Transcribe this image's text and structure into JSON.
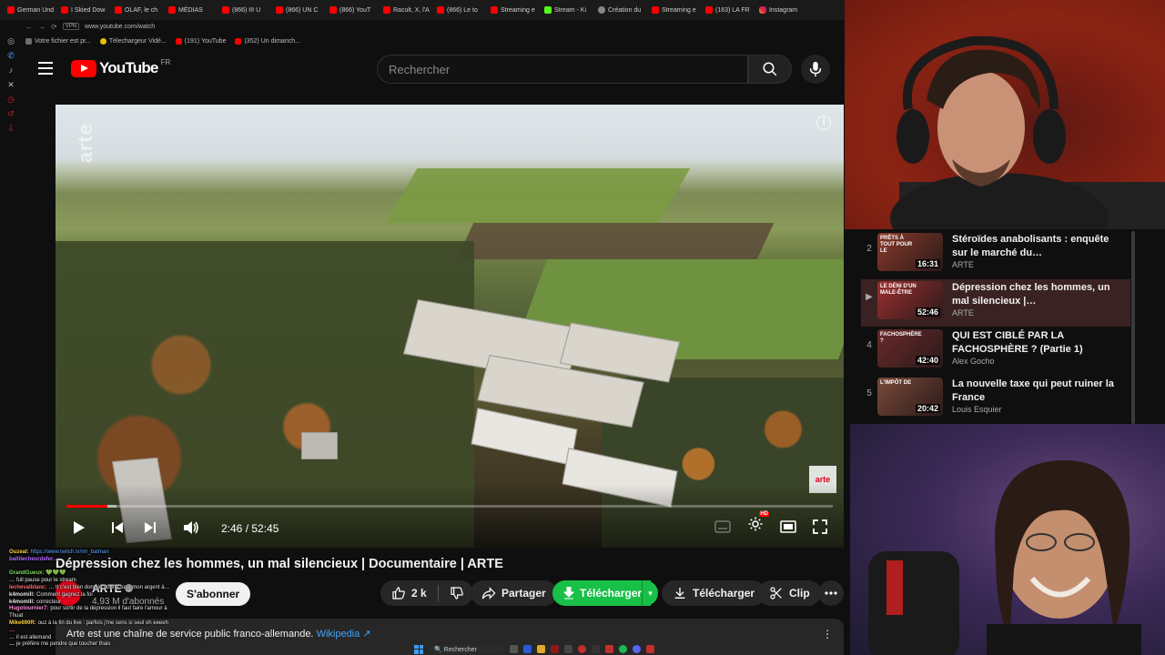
{
  "browser": {
    "tabs": [
      {
        "label": "German Und",
        "icon": "youtube"
      },
      {
        "label": "I Skied Dow",
        "icon": "youtube"
      },
      {
        "label": "OLAF, le ch",
        "icon": "youtube"
      },
      {
        "label": "MÉDIAS",
        "icon": "youtube"
      },
      {
        "label": "(866) ✉ U",
        "icon": "youtube"
      },
      {
        "label": "(866) UN C",
        "icon": "youtube"
      },
      {
        "label": "(866) YouT",
        "icon": "youtube"
      },
      {
        "label": "Racult, X, l'A",
        "icon": "youtube"
      },
      {
        "label": "(866) Le to",
        "icon": "youtube"
      },
      {
        "label": "Streaming e",
        "icon": "youtube"
      },
      {
        "label": "Stream - Ki",
        "icon": "kick"
      },
      {
        "label": "Création du",
        "icon": "generic"
      },
      {
        "label": "Streaming e",
        "icon": "youtube"
      },
      {
        "label": "(163) LA FR",
        "icon": "youtube"
      },
      {
        "label": "Instagram",
        "icon": "instagram"
      }
    ],
    "address": {
      "badge": "VPN",
      "url": "www.youtube.com/watch"
    },
    "bookmarks": [
      {
        "label": "Votre fichier est pr...",
        "icon": "generic"
      },
      {
        "label": "Télechargeur Vidé...",
        "icon": "yellow"
      },
      {
        "label": "(191) YouTube",
        "icon": "youtube"
      },
      {
        "label": "(352) Un dimanch...",
        "icon": "youtube"
      }
    ]
  },
  "header": {
    "logo_text": "YouTube",
    "country_code": "FR",
    "search_placeholder": "Rechercher"
  },
  "player": {
    "current_time": "2:46",
    "duration": "52:45",
    "time_display": "2:46 / 52:45",
    "played_fraction": 0.053,
    "buffered_fraction": 0.065,
    "watermark": "arte",
    "corner_logo": "arte",
    "hd_badge": "HD"
  },
  "video": {
    "title": "Dépression chez les hommes, un mal silencieux | Documentaire | ARTE",
    "channel": "ARTE",
    "subscribers": "4,93 M d'abonnés",
    "subscribe_label": "S'abonner",
    "likes": "2 k",
    "share_label": "Partager",
    "download_ext_label": "Télécharger",
    "download_label": "Télécharger",
    "clip_label": "Clip",
    "description": "Arte est une chaîne de service public franco-allemande.",
    "description_link": "Wikipedia ↗"
  },
  "chat": [
    {
      "user": "Ouzeal:",
      "text": "https://www.twitch.tv/mr_batman",
      "color": "#ffd23f",
      "link": true
    },
    {
      "user": "baltilecheurdefer…",
      "text": "",
      "color": "#b36bff"
    },
    {
      "user": "",
      "text": "",
      "color": "#e6e6e6"
    },
    {
      "user": "GrandGueux:",
      "text": "💚💚💚",
      "color": "#7ddc5a"
    },
    {
      "user": "…",
      "text": "full pause pour le stream",
      "color": "#5aa8ff"
    },
    {
      "user": "lechevalblanc:",
      "text": "… tt c'est bien donc je donne tous mon argent à…",
      "color": "#ff6b6b"
    },
    {
      "user": "k4momill:",
      "text": "Comment gagnez la foi",
      "color": "#e6e6e6"
    },
    {
      "user": "k4momill:",
      "text": "correcteur",
      "color": "#e6e6e6"
    },
    {
      "user": "Hugotournier7:",
      "text": "pour sortir de la dépression il faut faire l'amour à Thuat",
      "color": "#ff8ad8"
    },
    {
      "user": "Mike690R:",
      "text": "ouz à la fin du live : parfois j'me sens si seul oh eeeeh",
      "color": "#ffd23f"
    },
    {
      "user": "…",
      "text": "",
      "color": "#ff6b6b"
    },
    {
      "user": "…",
      "text": "il est allemand",
      "color": "#b36bff"
    },
    {
      "user": "…",
      "text": "je préfère me pendre que toucher thais",
      "color": "#e6e6e6"
    }
  ],
  "taskbar": {
    "search_label": "Rechercher"
  },
  "playlist": [
    {
      "index": "2",
      "title": "Stéroïdes anabolisants : enquête sur le marché du…",
      "channel": "ARTE",
      "duration": "16:31",
      "thumb_text": "PRÊTS À TOUT POUR LE",
      "active": false,
      "thumb_color": "#8a3a2a"
    },
    {
      "index": "▶",
      "title": "Dépression chez les hommes, un mal silencieux |…",
      "channel": "ARTE",
      "duration": "52:46",
      "thumb_text": "LE DÉNI D'UN MALE-ÊTRE",
      "active": true,
      "thumb_color": "#9e2f2f"
    },
    {
      "index": "4",
      "title": "QUI EST CIBLÉ PAR LA FACHOSPHÈRE ? (Partie 1)",
      "channel": "Alex Gocho",
      "duration": "42:40",
      "thumb_text": "FACHOSPHÈRE ?",
      "active": false,
      "thumb_color": "#6a2a2a"
    },
    {
      "index": "5",
      "title": "La nouvelle taxe qui peut ruiner la France",
      "channel": "Louis Esquier",
      "duration": "20:42",
      "thumb_text": "L'IMPÔT DE",
      "active": false,
      "thumb_color": "#7a4a3a"
    }
  ],
  "colors": {
    "youtube_red": "#ff0000",
    "background": "#0f0f0f",
    "download_green": "#18c047",
    "link_blue": "#3ea6ff"
  }
}
